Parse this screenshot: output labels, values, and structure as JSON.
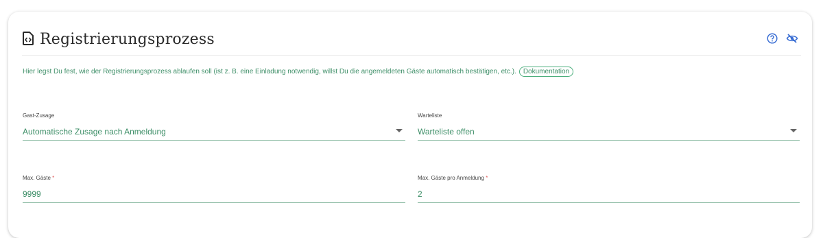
{
  "panel": {
    "title": "Registrierungsprozess",
    "title_icon": "code-file-icon",
    "help_icon": "help-circle-icon",
    "visibility_icon": "eye-off-icon",
    "accent_color": "#3d8e67"
  },
  "description": {
    "text": "Hier legst Du fest, wie der Registrierungsprozess ablaufen soll (ist z. B. eine Einladung notwendig, willst Du die angemeldeten Gäste automatisch bestätigen, etc.).",
    "link_label": "Dokumentation"
  },
  "fields": {
    "gast_zusage": {
      "label": "Gast-Zusage",
      "value": "Automatische Zusage nach Anmeldung"
    },
    "warteliste": {
      "label": "Warteliste",
      "value": "Warteliste offen"
    },
    "max_gaeste": {
      "label": "Max. Gäste",
      "required_mark": "*",
      "value": "9999"
    },
    "max_gaeste_pro_anmeldung": {
      "label": "Max. Gäste pro Anmeldung",
      "required_mark": "*",
      "value": "2"
    }
  }
}
